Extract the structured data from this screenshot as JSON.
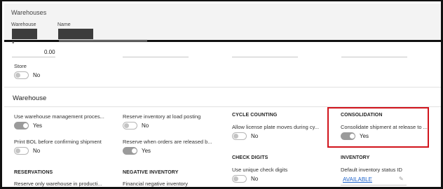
{
  "header": {
    "title": "Warehouses",
    "warehouse_label": "Warehouse",
    "name_label": "Name"
  },
  "top_section": {
    "amount": "0.00",
    "store_label": "Store",
    "store_value": "No"
  },
  "warehouse_section": {
    "title": "Warehouse",
    "use_wms_label": "Use warehouse management proces...",
    "use_wms_value": "Yes",
    "print_bol_label": "Print BOL before confirming shipment",
    "print_bol_value": "No",
    "reserve_inv_label": "Reserve inventory at load posting",
    "reserve_inv_value": "No",
    "reserve_released_label": "Reserve when orders are released b...",
    "reserve_released_value": "Yes",
    "cycle_counting_heading": "CYCLE COUNTING",
    "allow_lp_label": "Allow license plate moves during cy...",
    "allow_lp_value": "No",
    "consolidation_heading": "CONSOLIDATION",
    "consolidate_label": "Consolidate shipment at release to ...",
    "consolidate_value": "Yes",
    "check_digits_heading": "CHECK DIGITS",
    "unique_check_label": "Use unique check digits",
    "unique_check_value": "No",
    "inventory_heading": "INVENTORY",
    "default_status_label": "Default inventory status ID",
    "default_status_value": "AVAILABLE",
    "reservations_heading": "RESERVATIONS",
    "reserve_only_label": "Reserve only warehouse in producti...",
    "negative_inventory_heading": "NEGATIVE INVENTORY",
    "financial_negative_label": "Financial negative inventory"
  },
  "colors": {
    "highlight_box": "#d1141c",
    "link": "#2266cc"
  },
  "toggles": {
    "store": false,
    "use_wms": true,
    "print_bol": false,
    "reserve_inv": false,
    "reserve_released": true,
    "allow_lp": false,
    "consolidate": true,
    "unique_check": false
  }
}
